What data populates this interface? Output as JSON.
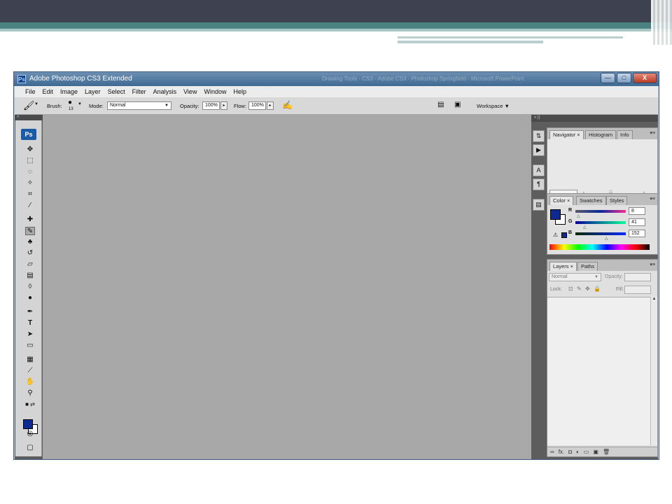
{
  "window": {
    "title": "Adobe Photoshop CS3 Extended",
    "ps_logo": "Ps",
    "background_titles": "Drawing Tools  ·  CS3  ·  Adobe CS3  ·  Photoshop Springfield  ·  Microsoft PowerPoint"
  },
  "window_buttons": {
    "minimize": "—",
    "maximize": "□",
    "close": "X"
  },
  "menu": [
    "File",
    "Edit",
    "Image",
    "Layer",
    "Select",
    "Filter",
    "Analysis",
    "View",
    "Window",
    "Help"
  ],
  "options": {
    "brush_label": "Brush:",
    "brush_size": "13",
    "mode_label": "Mode:",
    "mode_value": "Normal",
    "opacity_label": "Opacity:",
    "opacity_value": "100%",
    "flow_label": "Flow:",
    "flow_value": "100%",
    "workspace_label": "Workspace ▼"
  },
  "toolbox": {
    "badge": "Ps",
    "strip": "»"
  },
  "dock": {
    "strip": "«  ||"
  },
  "navigator_panel": {
    "tabs": [
      "Navigator",
      "Histogram",
      "Info"
    ]
  },
  "color_panel": {
    "tabs": [
      "Color",
      "Swatches",
      "Styles"
    ],
    "r_label": "R",
    "r_value": "8",
    "g_label": "G",
    "g_value": "41",
    "b_label": "B",
    "b_value": "152",
    "foreground": "#0c2a91"
  },
  "layers_panel": {
    "tabs": [
      "Layers",
      "Paths"
    ],
    "blend_mode": "Normal",
    "opacity_label": "Opacity:",
    "lock_label": "Lock:",
    "fill_label": "Fill:",
    "footer_icons": [
      "link-icon",
      "fx-icon",
      "mask-icon",
      "adjustment-icon",
      "folder-icon",
      "new-layer-icon",
      "trash-icon"
    ],
    "footer_glyphs": [
      "∞",
      "fx.",
      "◘",
      "◐",
      "▭",
      "▣",
      "🗑"
    ]
  }
}
